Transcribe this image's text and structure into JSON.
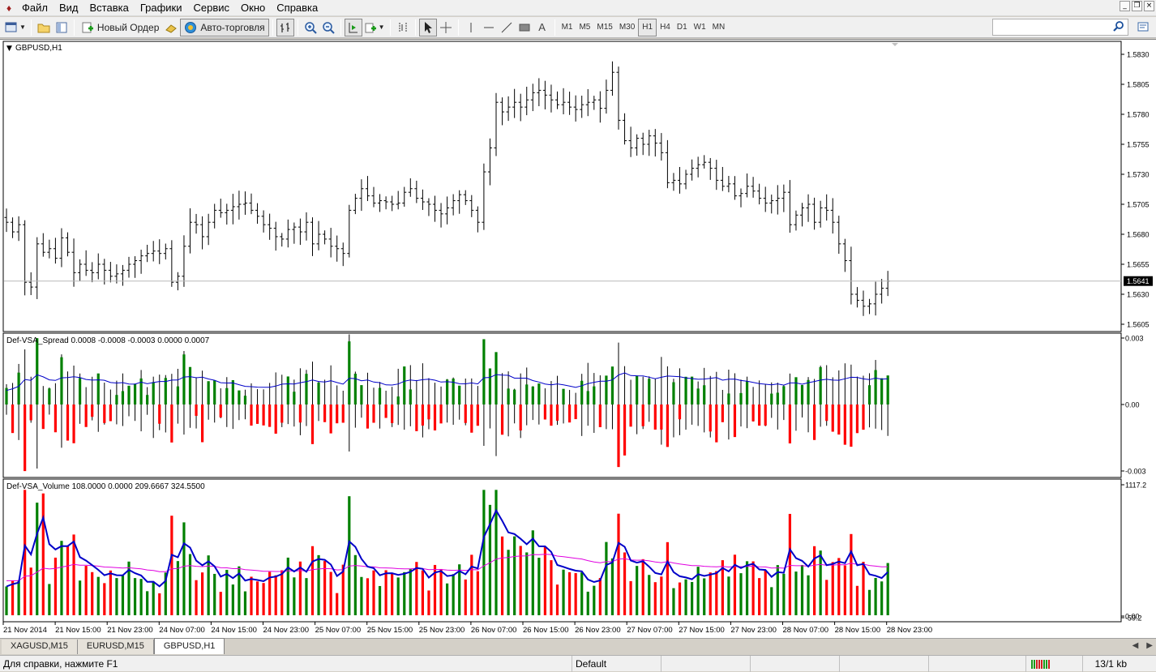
{
  "menu": {
    "items": [
      "Файл",
      "Вид",
      "Вставка",
      "Графики",
      "Сервис",
      "Окно",
      "Справка"
    ]
  },
  "toolbar": {
    "new_order_label": "Новый Ордер",
    "autotrade_label": "Авто-торговля",
    "timeframes": [
      "M1",
      "M5",
      "M15",
      "M30",
      "H1",
      "H4",
      "D1",
      "W1",
      "MN"
    ],
    "active_timeframe": "H1",
    "text_tool": "A"
  },
  "chart": {
    "symbol_label": "GBPUSD,H1",
    "current_price": "1.5641",
    "price_ticks": [
      "1.5830",
      "1.5805",
      "1.5780",
      "1.5755",
      "1.5730",
      "1.5705",
      "1.5680",
      "1.5655",
      "1.5630",
      "1.5605"
    ],
    "spread_label": "Def-VSA_Spread 0.0008 -0.0008 -0.0003 0.0000 0.0007",
    "spread_ticks": [
      "0.003",
      "0.00",
      "-0.003"
    ],
    "volume_label": "Def-VSA_Volume 108.0000 0.0000 209.6667 324.5500",
    "volume_ticks": [
      "1117.2",
      "0.00",
      "-59.2"
    ],
    "time_labels": [
      "21 Nov 2014",
      "21 Nov 15:00",
      "21 Nov 23:00",
      "24 Nov 07:00",
      "24 Nov 15:00",
      "24 Nov 23:00",
      "25 Nov 07:00",
      "25 Nov 15:00",
      "25 Nov 23:00",
      "26 Nov 07:00",
      "26 Nov 15:00",
      "26 Nov 23:00",
      "27 Nov 07:00",
      "27 Nov 15:00",
      "27 Nov 23:00",
      "28 Nov 07:00",
      "28 Nov 15:00",
      "28 Nov 23:00"
    ],
    "colors": {
      "bull": "#008000",
      "bear": "#ff0000",
      "ma_blue": "#0000c8",
      "ma_magenta": "#e000e0",
      "bars": "#000000",
      "price_tag_bg": "#000000"
    }
  },
  "chart_data": {
    "type": "bar",
    "title": "GBPUSD,H1",
    "ylim": [
      1.5595,
      1.584
    ],
    "closes": [
      1.569,
      1.5682,
      1.5688,
      1.564,
      1.5636,
      1.5672,
      1.5665,
      1.5668,
      1.566,
      1.5677,
      1.5665,
      1.5648,
      1.5655,
      1.565,
      1.5648,
      1.5655,
      1.565,
      1.5645,
      1.5647,
      1.565,
      1.5655,
      1.5658,
      1.5662,
      1.5664,
      1.5666,
      1.5664,
      1.5668,
      1.564,
      1.5645,
      1.567,
      1.569,
      1.5688,
      1.5678,
      1.569,
      1.57,
      1.5698,
      1.57,
      1.5703,
      1.5705,
      1.5706,
      1.57,
      1.5695,
      1.5688,
      1.5685,
      1.5678,
      1.5676,
      1.5684,
      1.5686,
      1.5682,
      1.569,
      1.5672,
      1.568,
      1.5676,
      1.567,
      1.5668,
      1.5664,
      1.57,
      1.571,
      1.5718,
      1.5712,
      1.5706,
      1.5708,
      1.5707,
      1.5705,
      1.5706,
      1.5715,
      1.5718,
      1.571,
      1.5707,
      1.5705,
      1.57,
      1.5697,
      1.5702,
      1.5708,
      1.5713,
      1.5708,
      1.57,
      1.569,
      1.5732,
      1.5752,
      1.579,
      1.5782,
      1.5786,
      1.579,
      1.5786,
      1.5792,
      1.5798,
      1.58,
      1.5796,
      1.5792,
      1.5788,
      1.579,
      1.5786,
      1.5784,
      1.5788,
      1.579,
      1.5792,
      1.5785,
      1.58,
      1.5815,
      1.5775,
      1.5758,
      1.5752,
      1.576,
      1.5755,
      1.5762,
      1.5756,
      1.5748,
      1.5723,
      1.5725,
      1.5722,
      1.573,
      1.5735,
      1.5738,
      1.574,
      1.5735,
      1.5725,
      1.572,
      1.5722,
      1.5712,
      1.5714,
      1.572,
      1.5716,
      1.571,
      1.5706,
      1.5708,
      1.571,
      1.5715,
      1.5688,
      1.5696,
      1.5702,
      1.5705,
      1.569,
      1.5702,
      1.57,
      1.569,
      1.5672,
      1.5658,
      1.563,
      1.5625,
      1.562,
      1.5622,
      1.563,
      1.5635,
      1.5641
    ]
  }
}
